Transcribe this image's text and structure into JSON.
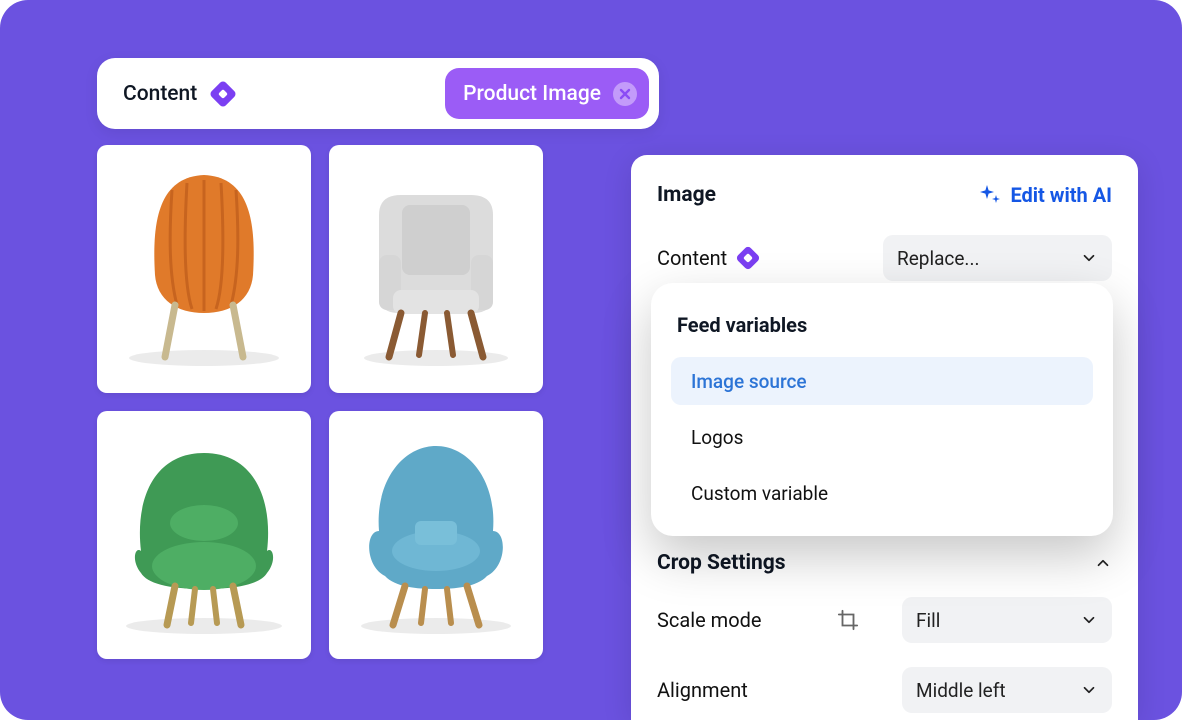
{
  "topbar": {
    "label": "Content",
    "chip": "Product Image"
  },
  "panel": {
    "title": "Image",
    "ai_link": "Edit with AI",
    "content_label": "Content",
    "replace_value": "Replace...",
    "crop_title": "Crop Settings",
    "scale_label": "Scale mode",
    "scale_value": "Fill",
    "align_label": "Alignment",
    "align_value": "Middle left"
  },
  "dropdown": {
    "title": "Feed variables",
    "items": [
      {
        "label": "Image source",
        "selected": true
      },
      {
        "label": "Logos",
        "selected": false
      },
      {
        "label": "Custom variable",
        "selected": false
      }
    ]
  },
  "thumbnails": [
    {
      "name": "orange-chair"
    },
    {
      "name": "gray-chair"
    },
    {
      "name": "green-chair"
    },
    {
      "name": "blue-chair"
    }
  ]
}
